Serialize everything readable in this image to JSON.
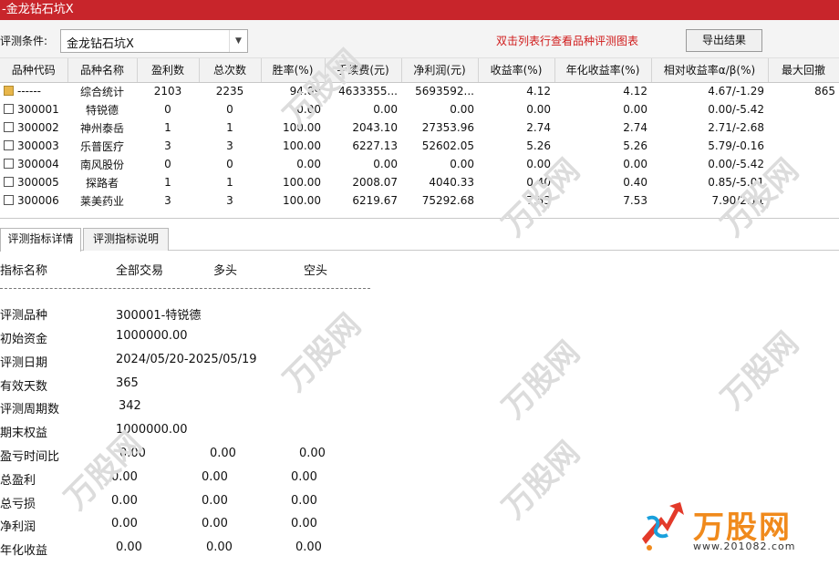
{
  "window": {
    "title": "-金龙钻石坑X"
  },
  "toolbar": {
    "condition_label": "评测条件:",
    "condition_value": "金龙钻石坑X",
    "hint": "双击列表行查看品种评测图表",
    "export_label": "导出结果"
  },
  "table": {
    "headers": [
      "品种代码",
      "品种名称",
      "盈利数",
      "总次数",
      "胜率(%)",
      "手续费(元)",
      "净利润(元)",
      "收益率(%)",
      "年化收益率(%)",
      "相对收益率α/β(%)",
      "最大回撤"
    ],
    "rows": [
      {
        "code": "------",
        "name": "综合统计",
        "win": "2103",
        "total": "2235",
        "rate": "94.09",
        "fee": "4633355...",
        "profit": "5693592...",
        "ret": "4.12",
        "annual": "4.12",
        "rel": "4.67/-1.29",
        "dd": "865"
      },
      {
        "code": "300001",
        "name": "特锐德",
        "win": "0",
        "total": "0",
        "rate": "0.00",
        "fee": "0.00",
        "profit": "0.00",
        "ret": "0.00",
        "annual": "0.00",
        "rel": "0.00/-5.42",
        "dd": ""
      },
      {
        "code": "300002",
        "name": "神州泰岳",
        "win": "1",
        "total": "1",
        "rate": "100.00",
        "fee": "2043.10",
        "profit": "27353.96",
        "ret": "2.74",
        "annual": "2.74",
        "rel": "2.71/-2.68",
        "dd": ""
      },
      {
        "code": "300003",
        "name": "乐普医疗",
        "win": "3",
        "total": "3",
        "rate": "100.00",
        "fee": "6227.13",
        "profit": "52602.05",
        "ret": "5.26",
        "annual": "5.26",
        "rel": "5.79/-0.16",
        "dd": ""
      },
      {
        "code": "300004",
        "name": "南风股份",
        "win": "0",
        "total": "0",
        "rate": "0.00",
        "fee": "0.00",
        "profit": "0.00",
        "ret": "0.00",
        "annual": "0.00",
        "rel": "0.00/-5.42",
        "dd": ""
      },
      {
        "code": "300005",
        "name": "探路者",
        "win": "1",
        "total": "1",
        "rate": "100.00",
        "fee": "2008.07",
        "profit": "4040.33",
        "ret": "0.40",
        "annual": "0.40",
        "rel": "0.85/-5.01",
        "dd": ""
      },
      {
        "code": "300006",
        "name": "莱美药业",
        "win": "3",
        "total": "3",
        "rate": "100.00",
        "fee": "6219.67",
        "profit": "75292.68",
        "ret": "7.53",
        "annual": "7.53",
        "rel": "7.90/2.11",
        "dd": ""
      }
    ]
  },
  "tabs": [
    "评测指标详情",
    "评测指标说明"
  ],
  "details": {
    "col_headers": [
      "指标名称",
      "全部交易",
      "多头",
      "空头"
    ],
    "rows": [
      {
        "label": "评测品种",
        "v1": "300001-特锐德"
      },
      {
        "label": "初始资金",
        "v1": "1000000.00"
      },
      {
        "label": "评测日期",
        "v1": "2024/05/20-2025/05/19"
      },
      {
        "label": "有效天数",
        "v1": "365"
      },
      {
        "label": "评测周期数",
        "v1": "342"
      },
      {
        "label": "期末权益",
        "v1": "1000000.00"
      },
      {
        "label": "盈亏时间比",
        "v1": "0.00",
        "v2": "0.00",
        "v3": "0.00"
      },
      {
        "label": "总盈利",
        "v1": "0.00",
        "v2": "0.00",
        "v3": "0.00"
      },
      {
        "label": "总亏损",
        "v1": "0.00",
        "v2": "0.00",
        "v3": "0.00"
      },
      {
        "label": "净利润",
        "v1": "0.00",
        "v2": "0.00",
        "v3": "0.00"
      },
      {
        "label": "年化收益",
        "v1": "0.00",
        "v2": "0.00",
        "v3": "0.00"
      }
    ]
  },
  "watermark": {
    "text": "万股网",
    "logo_text": "万股网",
    "url": "www.201082.com"
  },
  "colors": {
    "titlebar": "#c8252b",
    "hint": "#d01b1b",
    "logo": "#f08a1c"
  },
  "icons": {
    "folder": "folder-icon",
    "checkbox": "checkbox-icon",
    "dropdown": "chevron-down-icon"
  }
}
